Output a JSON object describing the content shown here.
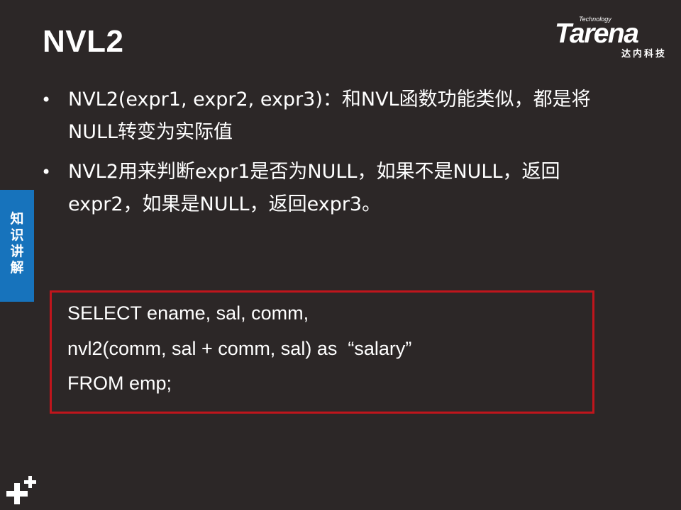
{
  "slide": {
    "title": "NVL2",
    "bullets": [
      "NVL2(expr1, expr2, expr3)：和NVL函数功能类似，都是将NULL转变为实际值",
      "NVL2用来判断expr1是否为NULL，如果不是NULL，返回expr2，如果是NULL，返回expr3。"
    ],
    "code_lines": [
      "SELECT ename, sal, comm,",
      "nvl2(comm, sal + comm, sal) as  “salary”",
      "FROM emp;"
    ]
  },
  "logo": {
    "technology": "Technology",
    "brand": "Tarena",
    "cn_name": "达内科技"
  },
  "side_tab": {
    "label": "知识讲解"
  },
  "colors": {
    "background": "#2c2727",
    "side_tab": "#1773bc",
    "code_border": "#c0151c",
    "text": "#ffffff"
  },
  "icons": {
    "footer": "plus-sparkle-icon"
  }
}
